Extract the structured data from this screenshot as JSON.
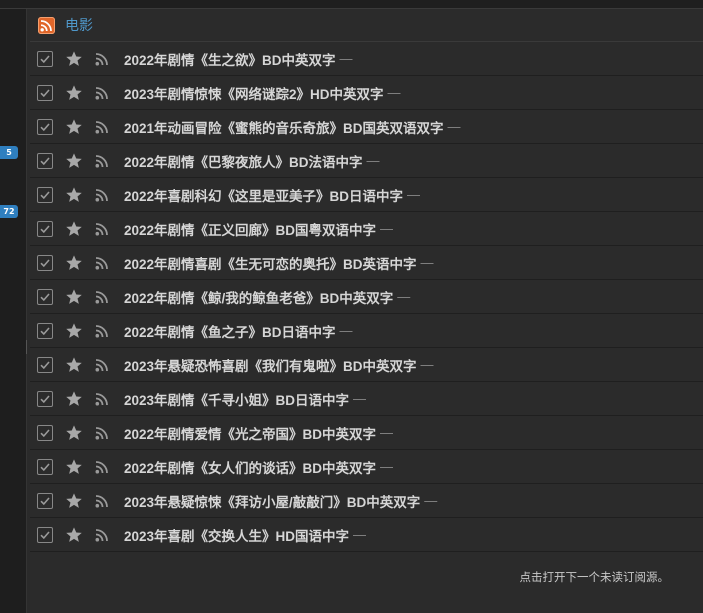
{
  "feed": {
    "title": "电影",
    "icon": "rss-feed-icon"
  },
  "sidebar": {
    "badges": [
      "5",
      "72"
    ]
  },
  "items": [
    {
      "title": "2022年剧情《生之欲》BD中英双字",
      "dash": "—"
    },
    {
      "title": "2023年剧情惊悚《网络谜踪2》HD中英双字",
      "dash": "—"
    },
    {
      "title": "2021年动画冒险《蜜熊的音乐奇旅》BD国英双语双字",
      "dash": "—"
    },
    {
      "title": "2022年剧情《巴黎夜旅人》BD法语中字",
      "dash": "—"
    },
    {
      "title": "2022年喜剧科幻《这里是亚美子》BD日语中字",
      "dash": "—"
    },
    {
      "title": "2022年剧情《正义回廊》BD国粤双语中字",
      "dash": "—"
    },
    {
      "title": "2022年剧情喜剧《生无可恋的奥托》BD英语中字",
      "dash": "—"
    },
    {
      "title": "2022年剧情《鲸/我的鲸鱼老爸》BD中英双字",
      "dash": "—"
    },
    {
      "title": "2022年剧情《鱼之子》BD日语中字",
      "dash": "—"
    },
    {
      "title": "2023年悬疑恐怖喜剧《我们有鬼啦》BD中英双字",
      "dash": "—"
    },
    {
      "title": "2023年剧情《千寻小姐》BD日语中字",
      "dash": "—"
    },
    {
      "title": "2022年剧情爱情《光之帝国》BD中英双字",
      "dash": "—"
    },
    {
      "title": "2022年剧情《女人们的谈话》BD中英双字",
      "dash": "—"
    },
    {
      "title": "2023年悬疑惊悚《拜访小屋/敲敲门》BD中英双字",
      "dash": "—"
    },
    {
      "title": "2023年喜剧《交换人生》HD国语中字",
      "dash": "—"
    }
  ],
  "footer": {
    "hint": "点击打开下一个未读订阅源。"
  },
  "colors": {
    "accent": "#4f97c9",
    "rss": "#e0662a",
    "badge": "#2f7fbf"
  }
}
